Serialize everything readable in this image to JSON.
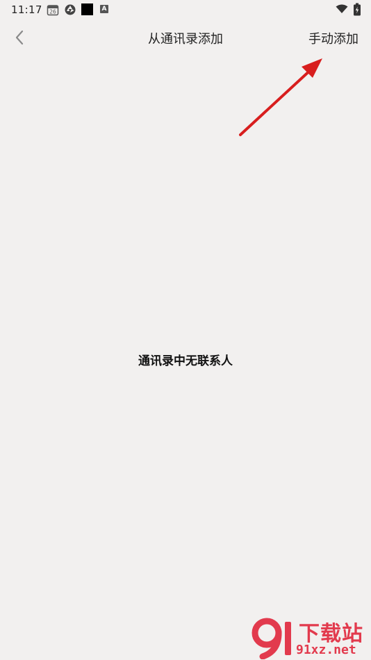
{
  "status_bar": {
    "time": "11:17",
    "calendar_day": "26",
    "notification_letter": "A"
  },
  "nav": {
    "title": "从通讯录添加",
    "action_label": "手动添加"
  },
  "empty_state": {
    "message": "通讯录中无联系人"
  },
  "watermark": {
    "title": "下载站",
    "domain": "91xz.net"
  },
  "colors": {
    "background": "#f2f0ef",
    "annotation_arrow": "#d81e1e",
    "watermark": "#e23a4d"
  },
  "icons": [
    "calendar-icon",
    "shutter-icon",
    "black-square-icon",
    "a-notification-icon",
    "wifi-icon",
    "battery-icon",
    "back-chevron-icon",
    "annotation-arrow"
  ]
}
